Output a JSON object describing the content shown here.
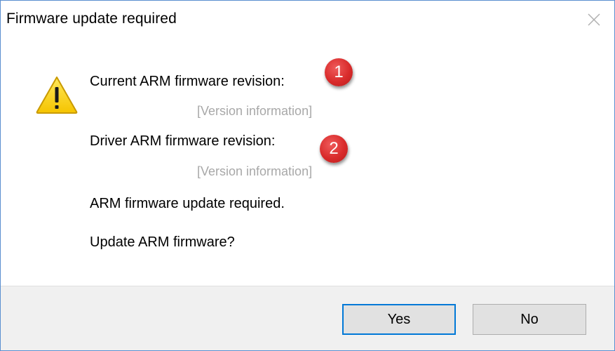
{
  "dialog": {
    "title": "Firmware update required",
    "close_icon": "close-icon",
    "warning_icon": "warning-icon"
  },
  "content": {
    "current_label": "Current ARM firmware revision:",
    "current_version": "[Version information]",
    "driver_label": "Driver ARM firmware revision:",
    "driver_version": "[Version information]",
    "update_required": "ARM firmware update required.",
    "update_question": "Update ARM firmware?"
  },
  "annotations": {
    "badge_1": "1",
    "badge_2": "2",
    "badge_color": "#d92b2b"
  },
  "buttons": {
    "yes_label": "Yes",
    "no_label": "No",
    "default_border_color": "#0078d7"
  }
}
